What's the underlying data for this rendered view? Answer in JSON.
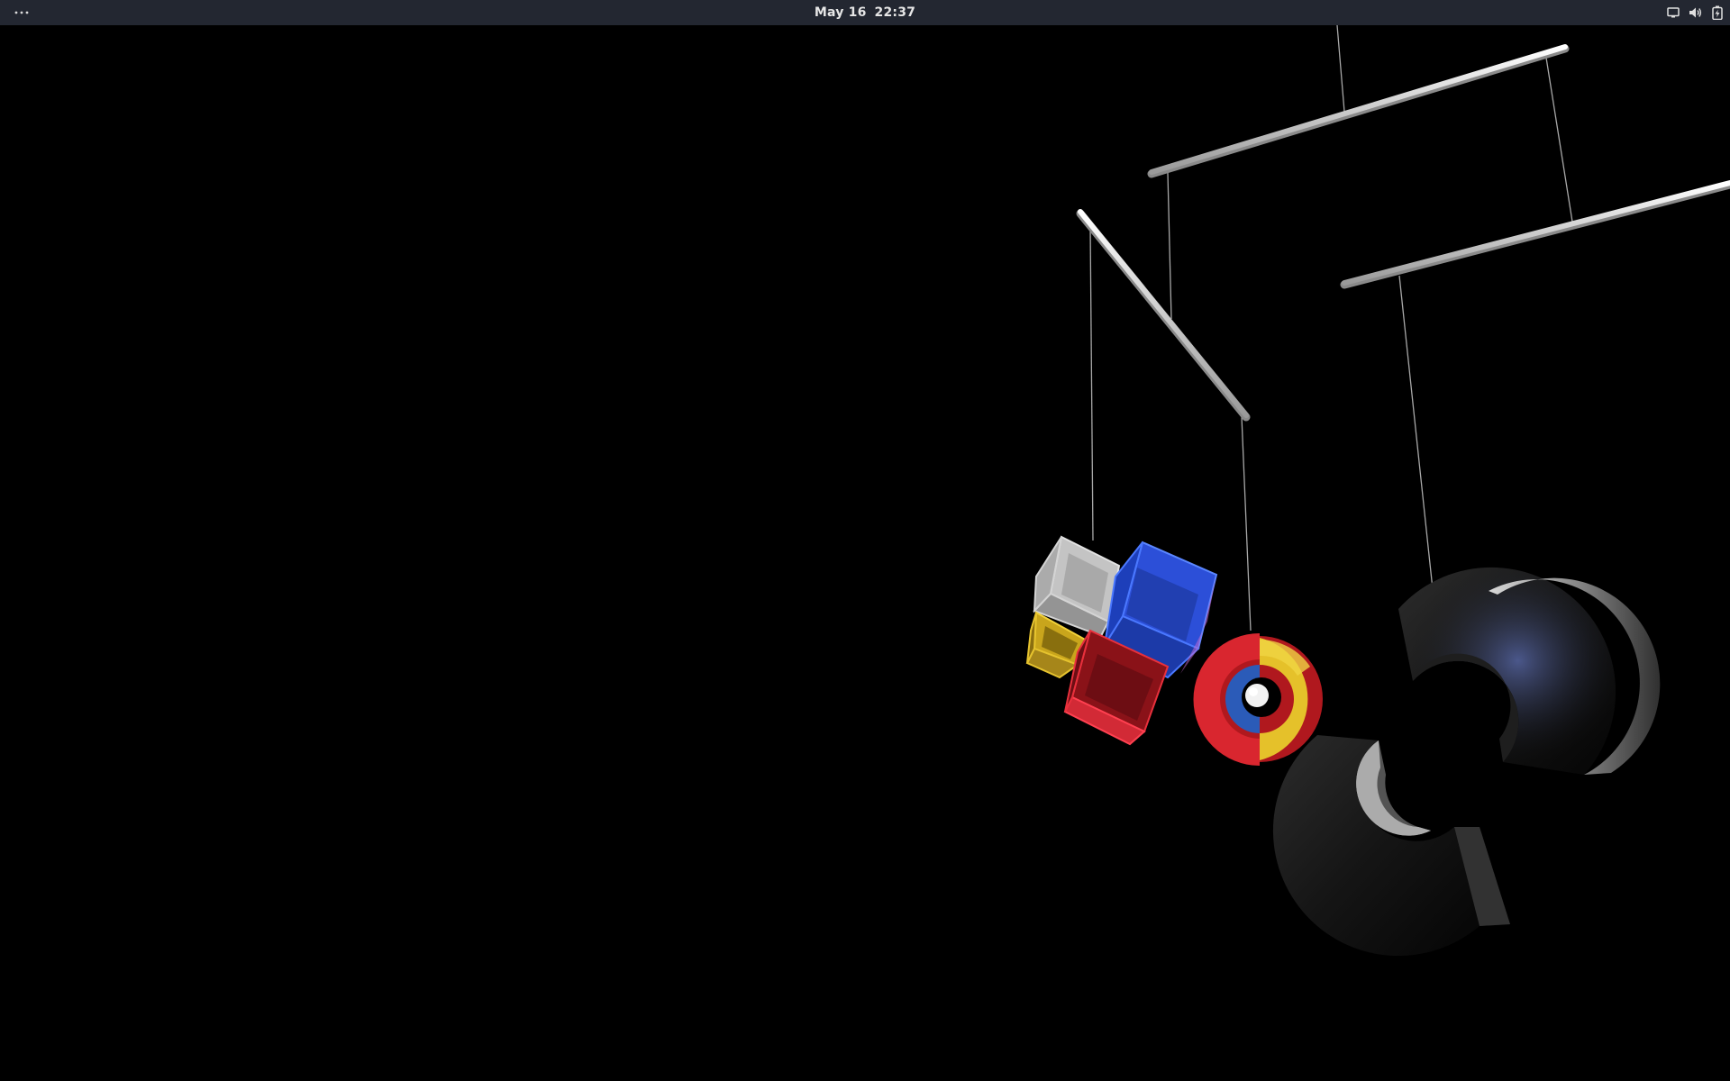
{
  "top_bar": {
    "activities_icon": "ellipsis-icon",
    "clock": {
      "date": "May 16",
      "time": "22:37"
    },
    "tray_icons": [
      "screen-icon",
      "volume-icon",
      "battery-icon"
    ]
  },
  "desktop": {
    "wallpaper": "hanging-mobile-sculpture",
    "background_color": "#000000",
    "shape_colors": {
      "red": "#d9262f",
      "yellow": "#e5c12a",
      "blue": "#2b5bd9",
      "white": "#e6e6e6"
    }
  }
}
